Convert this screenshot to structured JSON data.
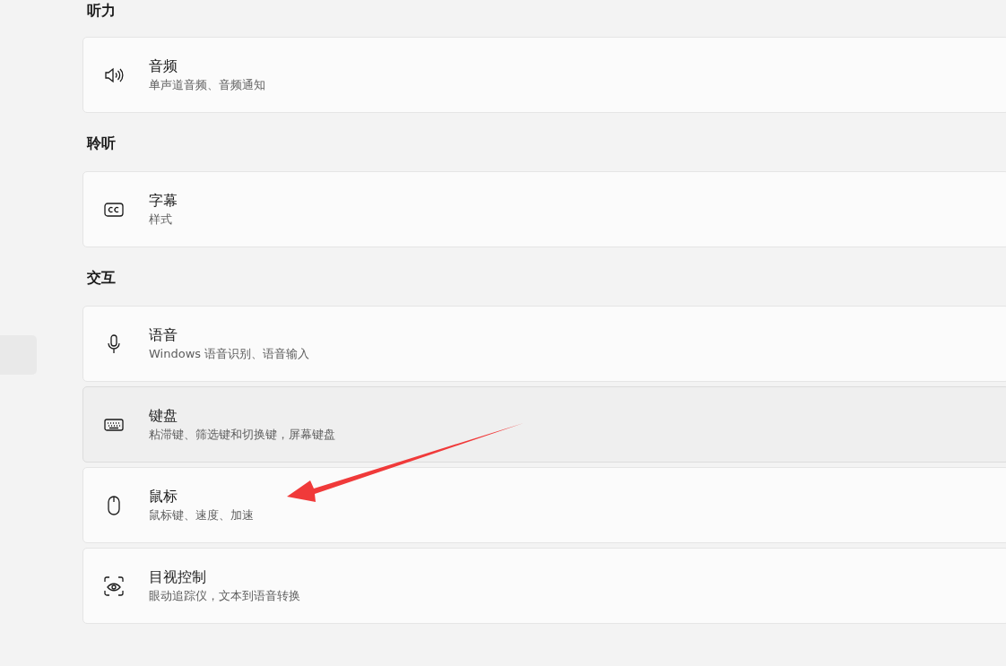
{
  "sections": [
    {
      "heading": "听力",
      "items": [
        {
          "kind": "speaker",
          "title": "音频",
          "subtitle": "单声道音频、音频通知",
          "hovered": false
        }
      ]
    },
    {
      "heading": "聆听",
      "items": [
        {
          "kind": "cc",
          "title": "字幕",
          "subtitle": "样式",
          "hovered": false
        }
      ]
    },
    {
      "heading": "交互",
      "items": [
        {
          "kind": "mic",
          "title": "语音",
          "subtitle": "Windows 语音识别、语音输入",
          "hovered": false
        },
        {
          "kind": "keyboard",
          "title": "键盘",
          "subtitle": "粘滞键、筛选键和切换键，屏幕键盘",
          "hovered": true
        },
        {
          "kind": "mouse",
          "title": "鼠标",
          "subtitle": "鼠标键、速度、加速",
          "hovered": false
        },
        {
          "kind": "eye",
          "title": "目视控制",
          "subtitle": "眼动追踪仪，文本到语音转换",
          "hovered": false
        }
      ]
    }
  ]
}
